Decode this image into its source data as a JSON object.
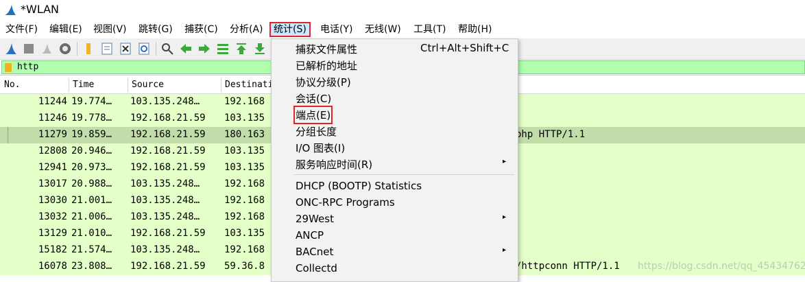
{
  "window": {
    "title": "*WLAN"
  },
  "menubar": {
    "items": [
      {
        "label": "文件(F)"
      },
      {
        "label": "编辑(E)"
      },
      {
        "label": "视图(V)"
      },
      {
        "label": "跳转(G)"
      },
      {
        "label": "捕获(C)"
      },
      {
        "label": "分析(A)"
      },
      {
        "label": "统计(S)"
      },
      {
        "label": "电话(Y)"
      },
      {
        "label": "无线(W)"
      },
      {
        "label": "工具(T)"
      },
      {
        "label": "帮助(H)"
      }
    ]
  },
  "filter": {
    "value": "http"
  },
  "columns": [
    {
      "label": "No."
    },
    {
      "label": "Time"
    },
    {
      "label": "Source"
    },
    {
      "label": "Destinati"
    }
  ],
  "packets": [
    {
      "no": "11244",
      "time": "19.774…",
      "src": "103.135.248…",
      "dst": "192.168",
      "info": ""
    },
    {
      "no": "11246",
      "time": "19.778…",
      "src": "192.168.21.59",
      "dst": "103.135",
      "info": ""
    },
    {
      "no": "11279",
      "time": "19.859…",
      "src": "192.168.21.59",
      "dst": "180.163",
      "info": "php HTTP/1.1"
    },
    {
      "no": "12808",
      "time": "20.946…",
      "src": "192.168.21.59",
      "dst": "103.135",
      "info": ""
    },
    {
      "no": "12941",
      "time": "20.973…",
      "src": "192.168.21.59",
      "dst": "103.135",
      "info": ""
    },
    {
      "no": "13017",
      "time": "20.988…",
      "src": "103.135.248…",
      "dst": "192.168",
      "info": ""
    },
    {
      "no": "13030",
      "time": "21.001…",
      "src": "103.135.248…",
      "dst": "192.168",
      "info": ""
    },
    {
      "no": "13032",
      "time": "21.006…",
      "src": "103.135.248…",
      "dst": "192.168",
      "info": ""
    },
    {
      "no": "13129",
      "time": "21.010…",
      "src": "192.168.21.59",
      "dst": "103.135",
      "info": ""
    },
    {
      "no": "15182",
      "time": "21.574…",
      "src": "103.135.248…",
      "dst": "192.168",
      "info": ""
    },
    {
      "no": "16078",
      "time": "23.808…",
      "src": "192.168.21.59",
      "dst": "59.36.8",
      "info": "/httpconn HTTP/1.1"
    }
  ],
  "statistics_menu": {
    "items": [
      {
        "label": "捕获文件属性",
        "shortcut": "Ctrl+Alt+Shift+C"
      },
      {
        "label": "已解析的地址"
      },
      {
        "label": "协议分级(P)"
      },
      {
        "label": "会话(C)"
      },
      {
        "label": "端点(E)"
      },
      {
        "label": "分组长度"
      },
      {
        "label": "I/O 图表(I)"
      },
      {
        "label": "服务响应时间(R)",
        "submenu_arrow": "▸"
      },
      {
        "label": "DHCP (BOOTP) Statistics"
      },
      {
        "label": "ONC-RPC Programs"
      },
      {
        "label": "29West",
        "submenu_arrow": "▸"
      },
      {
        "label": "ANCP"
      },
      {
        "label": "BACnet",
        "submenu_arrow": "▸"
      },
      {
        "label": "Collectd"
      }
    ]
  },
  "watermark": "https://blog.csdn.net/qq_45434762",
  "colors": {
    "highlight_box": "#e0242a",
    "row_bg": "#e4ffc7",
    "row_selected_bg": "#c2dcaa",
    "filter_bg": "#afffaf",
    "menu_active_bg": "#cce8ff"
  }
}
